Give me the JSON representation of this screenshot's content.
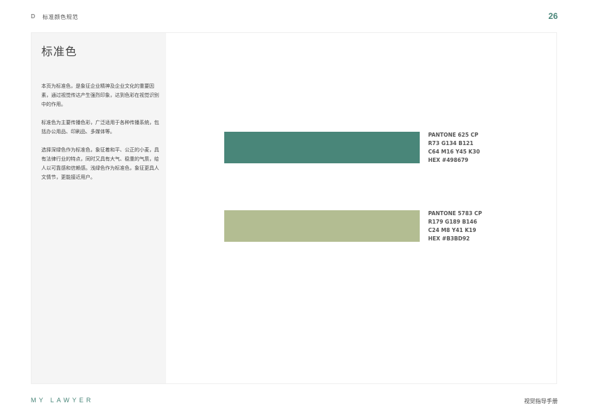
{
  "header": {
    "section_letter": "D",
    "section_title": "标准颜色规范",
    "page_number": "26"
  },
  "sidebar": {
    "title": "标准色",
    "paragraphs": [
      "本页为标准色，是象征企业精神及企业文化的重要因素，通过视觉传达产生强烈印象，达到色彩在视觉识别中的作用。",
      "标准色为主要传播色彩，广泛适用于各种传播系统，包括办公用品、印刷品、多媒体等。",
      "选择深绿色作为标准色，象征着和平、公正的小麦，具有法律行业的特点，同时又具有大气、稳重的气质，给人以可靠感和信赖感。浅绿色作为标准色，象征更具人文情节，更能接近用户。"
    ]
  },
  "colors": [
    {
      "hex": "#498679",
      "pantone": "PANTONE 625 CP",
      "rgb": "R73  G134  B121",
      "cmyk": "C64 M16 Y45 K30",
      "hex_label": "HEX #498679"
    },
    {
      "hex": "#B3BD92",
      "pantone": "PANTONE 5783 CP",
      "rgb": "R179 G189 B146",
      "cmyk": "C24 M8 Y41 K19",
      "hex_label": "HEX #B3BD92"
    }
  ],
  "footer": {
    "brand": "MY LAWYER",
    "doc_title": "视觉指导手册"
  }
}
